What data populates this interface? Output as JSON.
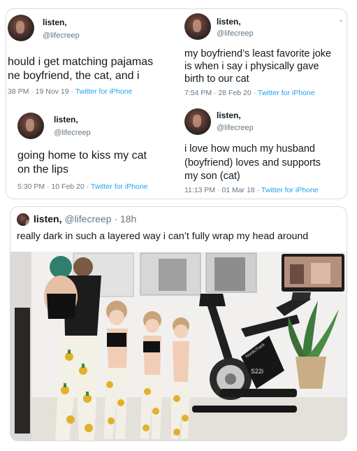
{
  "tweets": [
    {
      "name": "listen,",
      "handle": "@lifecreep",
      "text": "hould i get matching pajamas\nne boyfriend, the cat, and i",
      "time": "38 PM · 19 Nov 19 · ",
      "source": "Twitter for iPhone"
    },
    {
      "name": "listen,",
      "handle": "@lifecreep",
      "text": "my boyfriend’s least favorite joke\nis when i say i physically gave\nbirth to our cat",
      "time": "7:54 PM · 28 Feb 20 · ",
      "source": "Twitter for iPhone"
    },
    {
      "name": "listen,",
      "handle": "@lifecreep",
      "text": "going home to kiss my cat\non the lips",
      "time": "5:30 PM · 10 Feb 20 · ",
      "source": "Twitter for iPhone"
    },
    {
      "name": "listen,",
      "handle": "@lifecreep",
      "text": "i love how much my husband\n(boyfriend) loves and supports\nmy son (cat)",
      "time": "11:13 PM · 01 Mar 18 · ",
      "source": "Twitter for iPhone"
    }
  ],
  "bottom_tweet": {
    "name": "listen,",
    "handle": "@lifecreep",
    "separator": "·",
    "age": "18h",
    "text": "really dark in such a layered way i can’t fully wrap my head around"
  },
  "photo": {
    "bike_brand": "NordicTrack",
    "bike_model": "S22i"
  },
  "icons": {
    "chevron": "chevron-down-icon"
  }
}
